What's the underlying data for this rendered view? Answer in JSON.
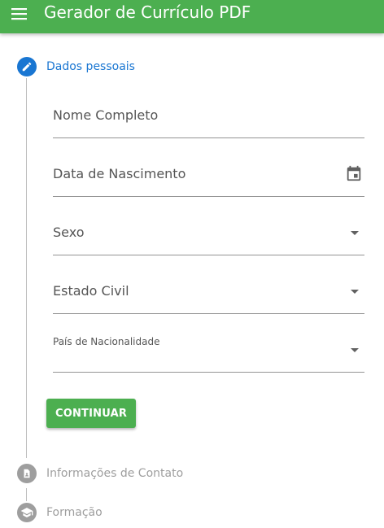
{
  "app_bar": {
    "title": "Gerador de Currículo PDF",
    "menu_icon": "menu-icon",
    "color": "#4caf50"
  },
  "stepper": {
    "steps": [
      {
        "label": "Dados pessoais",
        "icon": "pencil-icon",
        "state": "active"
      },
      {
        "label": "Informações de Contato",
        "icon": "contact-icon",
        "state": "inactive"
      },
      {
        "label": "Formação",
        "icon": "graduation-cap-icon",
        "state": "inactive"
      }
    ],
    "active_color": "#1976d2",
    "inactive_color": "#9e9e9e"
  },
  "form": {
    "fields": [
      {
        "label": "Nome Completo",
        "value": "",
        "type": "text"
      },
      {
        "label": "Data de Nascimento",
        "value": "",
        "type": "date",
        "icon": "calendar-icon"
      },
      {
        "label": "Sexo",
        "value": "",
        "type": "select"
      },
      {
        "label": "Estado Civil",
        "value": "",
        "type": "select"
      },
      {
        "label": "País de Nacionalidade",
        "value": "",
        "type": "select"
      }
    ],
    "continue_label": "CONTINUAR"
  }
}
